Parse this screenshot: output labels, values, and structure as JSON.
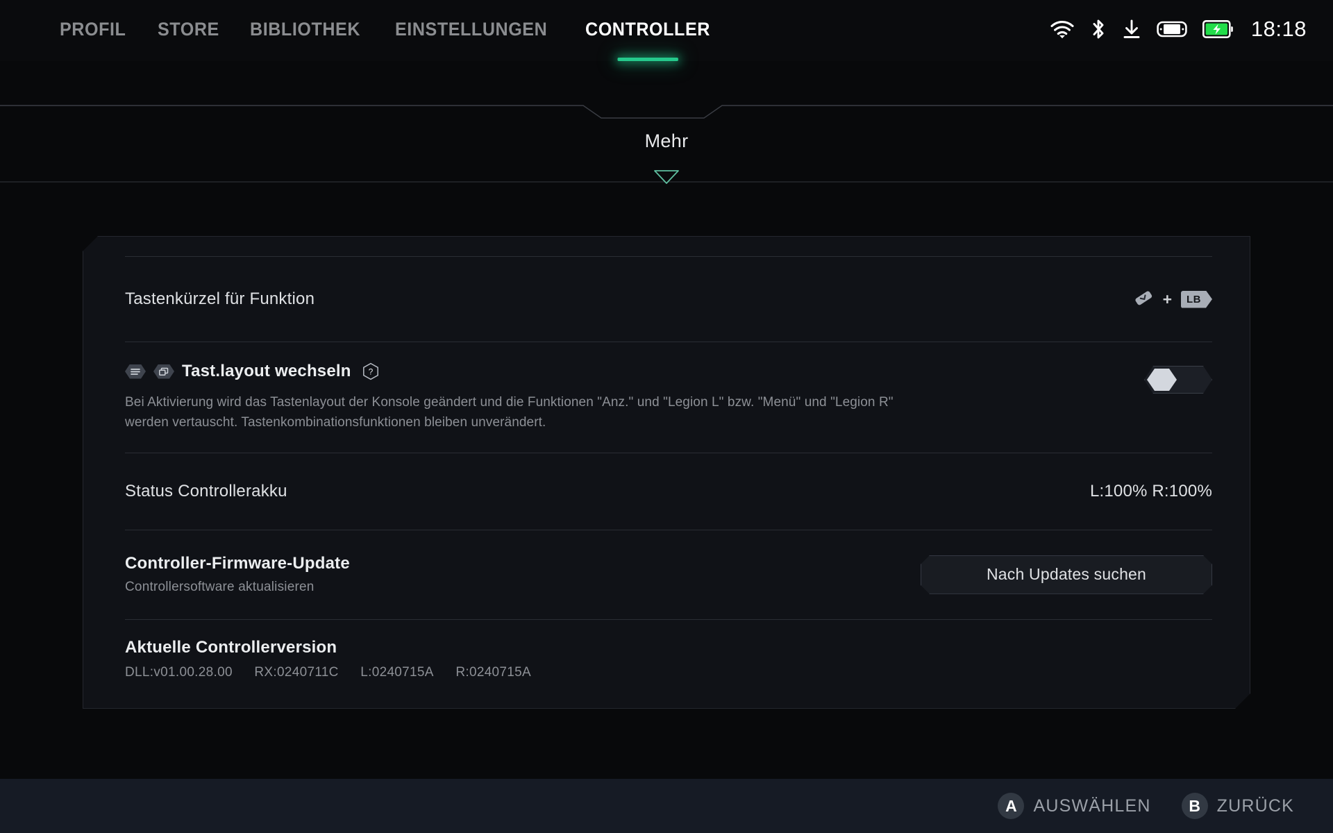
{
  "topnav": {
    "items": [
      {
        "label": "PROFIL",
        "active": false
      },
      {
        "label": "STORE",
        "active": false
      },
      {
        "label": "BIBLIOTHEK",
        "active": false
      },
      {
        "label": "EINSTELLUNGEN",
        "active": false
      },
      {
        "label": "CONTROLLER",
        "active": true
      }
    ],
    "accent_color": "#25c98c"
  },
  "status_bar": {
    "icons": [
      "wifi-icon",
      "bluetooth-icon",
      "download-icon",
      "handheld-device-icon",
      "battery-charging-icon"
    ],
    "battery_color": "#22dd4a",
    "clock": "18:18"
  },
  "section": {
    "title": "Mehr",
    "expand_caret": "caret-down-icon"
  },
  "rows": {
    "shortcut": {
      "title": "Tastenkürzel für Funktion",
      "combo_icon": "legion-button-icon",
      "plus": "+",
      "key": "LB"
    },
    "toggle": {
      "icon_left": "menu-hex-icon",
      "icon_right": "window-swap-hex-icon",
      "title": "Tast.layout wechseln",
      "help": "?",
      "description": "Bei Aktivierung wird das Tastenlayout der Konsole geändert und die Funktionen \"Anz.\" und \"Legion L\" bzw. \"Menü\" und \"Legion R\" werden vertauscht. Tastenkombinationsfunktionen bleiben unverändert.",
      "state": "off"
    },
    "battery": {
      "title": "Status Controllerakku",
      "value": "L:100% R:100%"
    },
    "firmware": {
      "title": "Controller-Firmware-Update",
      "subtitle": "Controllersoftware aktualisieren",
      "button": "Nach Updates suchen"
    },
    "version": {
      "title": "Aktuelle Controllerversion",
      "dll": "DLL:v01.00.28.00",
      "rx": "RX:0240711C",
      "left": "L:0240715A",
      "right": "R:0240715A"
    }
  },
  "bottom_hints": [
    {
      "badge": "A",
      "label": "AUSWÄHLEN"
    },
    {
      "badge": "B",
      "label": "ZURÜCK"
    }
  ]
}
